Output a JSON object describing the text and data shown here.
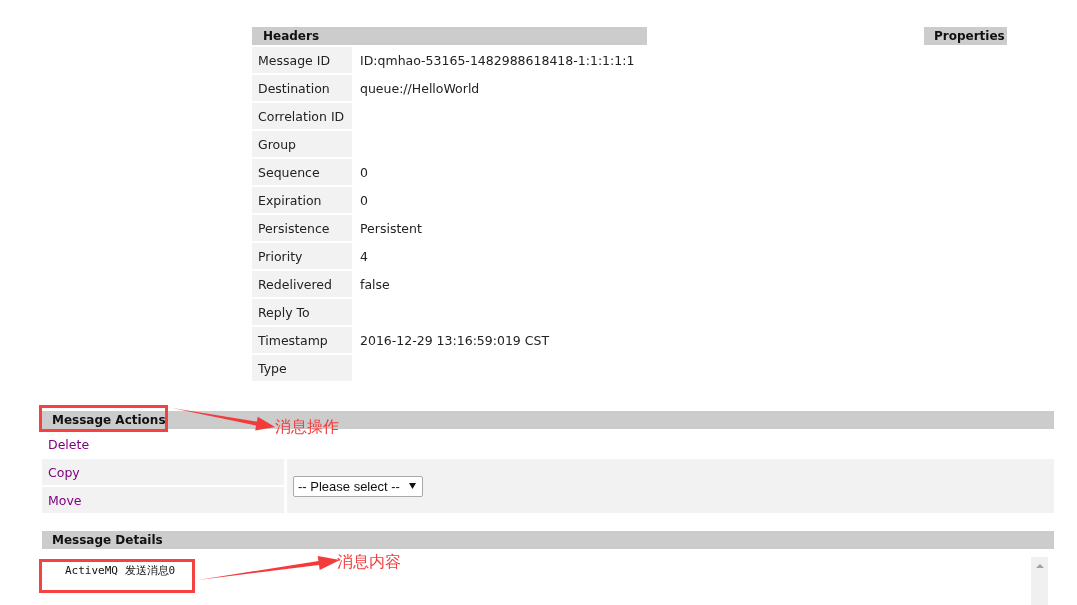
{
  "headers": {
    "title": "Headers",
    "rows": [
      {
        "label": "Message ID",
        "value": "ID:qmhao-53165-1482988618418-1:1:1:1:1"
      },
      {
        "label": "Destination",
        "value": "queue://HelloWorld"
      },
      {
        "label": "Correlation ID"
      },
      {
        "label": "Group"
      },
      {
        "label": "Sequence",
        "value": "0"
      },
      {
        "label": "Expiration",
        "value": "0"
      },
      {
        "label": "Persistence",
        "value": "Persistent"
      },
      {
        "label": "Priority",
        "value": "4"
      },
      {
        "label": "Redelivered",
        "value": "false"
      },
      {
        "label": "Reply To"
      },
      {
        "label": "Timestamp",
        "value": "2016-12-29 13:16:59:019 CST"
      },
      {
        "label": "Type"
      }
    ]
  },
  "properties": {
    "title": "Properties"
  },
  "message_actions": {
    "title": "Message Actions",
    "delete_link": "Delete",
    "transfer_links": [
      "Copy",
      "Move"
    ],
    "destination_select": {
      "value": "-- Please select --"
    },
    "annotation": {
      "text": "消息操作"
    }
  },
  "message_details": {
    "title": "Message Details",
    "body": "ActiveMQ 发送消息0",
    "annotation": {
      "text": "消息内容"
    }
  }
}
